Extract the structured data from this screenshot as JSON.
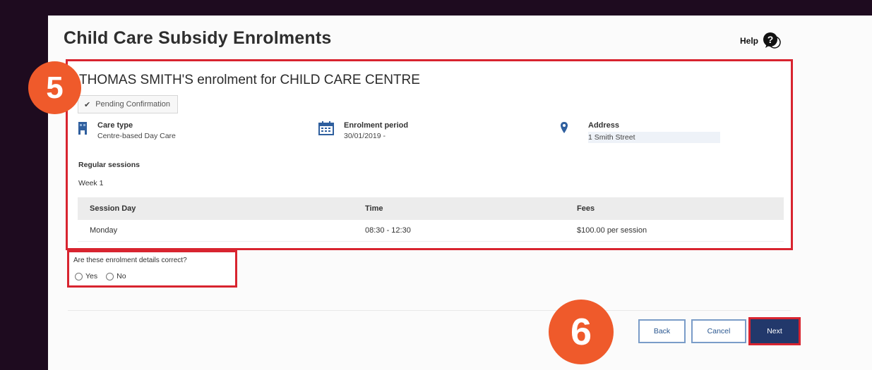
{
  "page": {
    "title": "Child Care Subsidy Enrolments",
    "help_label": "Help"
  },
  "enrolment": {
    "heading": "THOMAS SMITH'S enrolment for CHILD CARE CENTRE",
    "status": "Pending Confirmation",
    "care_type": {
      "label": "Care type",
      "value": "Centre-based Day Care"
    },
    "period": {
      "label": "Enrolment period",
      "value": "30/01/2019 -"
    },
    "address": {
      "label": "Address",
      "value": "1 Smith Street"
    },
    "regular_sessions_label": "Regular sessions",
    "week_label": "Week 1",
    "table": {
      "headers": [
        "Session Day",
        "Time",
        "Fees"
      ],
      "rows": [
        [
          "Monday",
          "08:30 - 12:30",
          "$100.00 per session"
        ]
      ]
    }
  },
  "confirm": {
    "question": "Are these enrolment details correct?",
    "yes_label": "Yes",
    "no_label": "No"
  },
  "buttons": {
    "back": "Back",
    "cancel": "Cancel",
    "next": "Next"
  },
  "callouts": {
    "step5": "5",
    "step6": "6"
  },
  "colors": {
    "highlight": "#d8242f",
    "callout": "#ef5a2b",
    "primary": "#22386b",
    "icon_blue": "#2f5f9e"
  }
}
